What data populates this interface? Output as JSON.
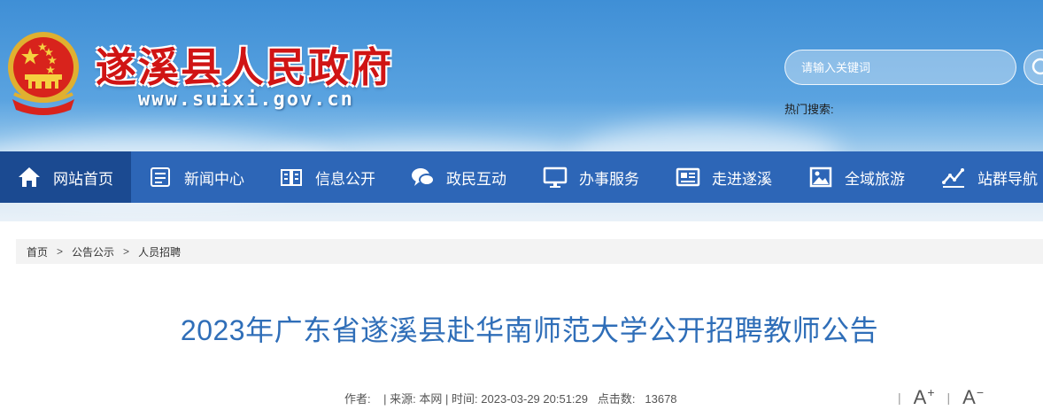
{
  "header": {
    "title": "遂溪县人民政府",
    "url": "www.suixi.gov.cn",
    "search_placeholder": "请输入关键词",
    "hot_search_label": "热门搜索:"
  },
  "nav": {
    "items": [
      {
        "label": "网站首页",
        "icon": "home-icon"
      },
      {
        "label": "新闻中心",
        "icon": "news-icon"
      },
      {
        "label": "信息公开",
        "icon": "book-icon"
      },
      {
        "label": "政民互动",
        "icon": "chat-icon"
      },
      {
        "label": "办事服务",
        "icon": "monitor-icon"
      },
      {
        "label": "走进遂溪",
        "icon": "newspaper-icon"
      },
      {
        "label": "全域旅游",
        "icon": "picture-icon"
      },
      {
        "label": "站群导航",
        "icon": "chart-icon"
      }
    ]
  },
  "breadcrumb": {
    "items": [
      "首页",
      "公告公示",
      "人员招聘"
    ],
    "separator": ">"
  },
  "article": {
    "title": "2023年广东省遂溪县赴华南师范大学公开招聘教师公告",
    "author_label": "作者:",
    "source_label": "来源:",
    "source": "本网",
    "time_label": "时间:",
    "time": "2023-03-29 20:51:29",
    "clicks_label": "点击数:",
    "clicks": "13678",
    "meta_separator": "|",
    "font_increase": "A",
    "font_increase_sign": "+",
    "font_decrease": "A",
    "font_decrease_sign": "−"
  },
  "colors": {
    "nav_bg": "#2d66b7",
    "nav_active": "#1b4a91",
    "title_red": "#d01414",
    "article_title": "#2f6eb8"
  }
}
